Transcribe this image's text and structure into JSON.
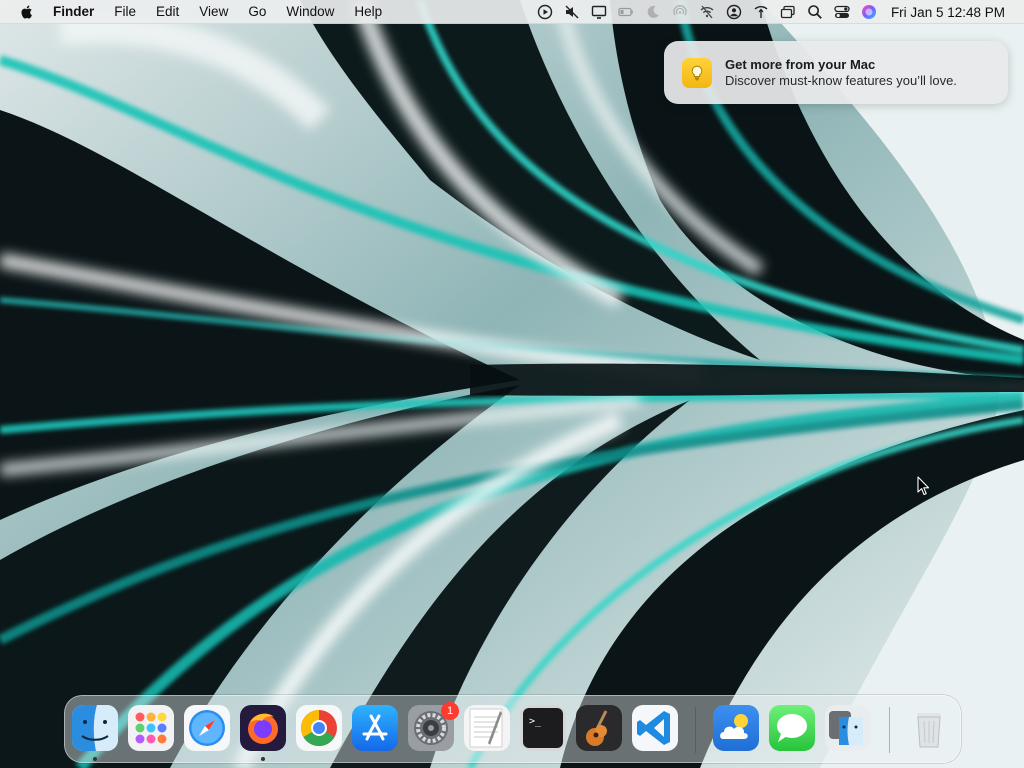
{
  "menubar": {
    "apple_icon": "apple-logo-icon",
    "app_name": "Finder",
    "menus": [
      "File",
      "Edit",
      "View",
      "Go",
      "Window",
      "Help"
    ],
    "status_icons": [
      "play-circle-icon",
      "mute-icon",
      "display-icon",
      "battery-icon",
      "moon-icon",
      "airdrop-icon",
      "wifi-off-icon",
      "user-icon",
      "vpn-icon",
      "window-icon",
      "search-icon",
      "control-center-icon",
      "siri-icon"
    ],
    "clock": "Fri Jan 5  12:48 PM"
  },
  "notification": {
    "icon": "lightbulb-icon",
    "title": "Get more from your Mac",
    "body": "Discover must-know features you’ll love.",
    "accent": "#f7c320"
  },
  "dock": {
    "apps": [
      {
        "name": "Finder",
        "icon": "finder-icon",
        "running": true
      },
      {
        "name": "Launchpad",
        "icon": "launchpad-icon",
        "running": false
      },
      {
        "name": "Safari",
        "icon": "safari-icon",
        "running": false
      },
      {
        "name": "Firefox",
        "icon": "firefox-icon",
        "running": true
      },
      {
        "name": "Chrome",
        "icon": "chrome-icon",
        "running": false
      },
      {
        "name": "App Store",
        "icon": "app-store-icon",
        "running": false
      },
      {
        "name": "System Settings",
        "icon": "system-settings-icon",
        "running": false,
        "badge": "1"
      },
      {
        "name": "TextEdit",
        "icon": "textedit-icon",
        "running": false
      },
      {
        "name": "Terminal",
        "icon": "terminal-icon",
        "running": false
      },
      {
        "name": "GarageBand",
        "icon": "garageband-icon",
        "running": false
      },
      {
        "name": "Visual Studio Code",
        "icon": "vscode-icon",
        "running": false
      },
      {
        "name": "Weather",
        "icon": "weather-icon",
        "running": false
      },
      {
        "name": "Messages",
        "icon": "messages-icon",
        "running": false
      },
      {
        "name": "Migration Assistant",
        "icon": "migration-assistant-icon",
        "running": false
      },
      {
        "name": "Trash",
        "icon": "trash-icon",
        "running": false
      }
    ],
    "colors": {
      "badge": "#ff3b30",
      "run_dot": "#333333"
    }
  },
  "wallpaper": {
    "palette": [
      "#0b1416",
      "#0f8f8a",
      "#36d1c4",
      "#dfe8ea"
    ]
  }
}
